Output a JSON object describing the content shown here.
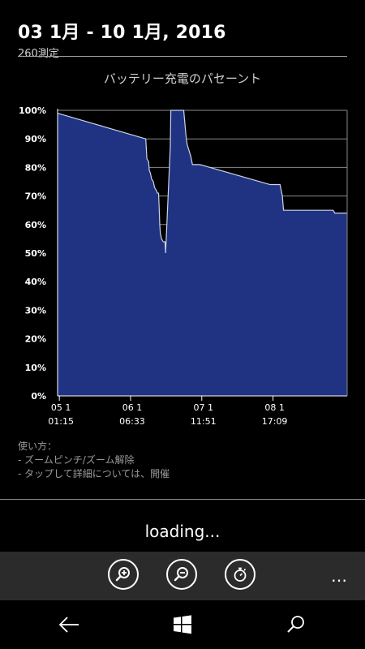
{
  "header": {
    "title": "03 1月 - 10 1月, 2016",
    "subtitle": "260測定"
  },
  "chart_data": {
    "type": "area",
    "title": "バッテリー充電のパセーント",
    "ylim": [
      0,
      100
    ],
    "y_ticks": [
      "0%",
      "10%",
      "20%",
      "30%",
      "40%",
      "50%",
      "60%",
      "70%",
      "80%",
      "90%",
      "100%"
    ],
    "x_ticks": [
      {
        "date": "05 1",
        "time": "01:15",
        "x": 1.0
      },
      {
        "date": "06 1",
        "time": "06:33",
        "x": 2.22
      },
      {
        "date": "07 1",
        "time": "11:51",
        "x": 3.44
      },
      {
        "date": "08 1",
        "time": "17:09",
        "x": 4.66
      }
    ],
    "xlim": [
      0.97,
      5.93
    ],
    "grid": true,
    "fill_color": "#1f3382",
    "line_color": "#cfd4e8",
    "points": [
      [
        0.97,
        99
      ],
      [
        2.48,
        90
      ],
      [
        2.5,
        83
      ],
      [
        2.53,
        82
      ],
      [
        2.54,
        79
      ],
      [
        2.56,
        78
      ],
      [
        2.58,
        76
      ],
      [
        2.61,
        75
      ],
      [
        2.63,
        73
      ],
      [
        2.66,
        72
      ],
      [
        2.68,
        71
      ],
      [
        2.7,
        71
      ],
      [
        2.71,
        66
      ],
      [
        2.72,
        60
      ],
      [
        2.73,
        57
      ],
      [
        2.75,
        55
      ],
      [
        2.78,
        54
      ],
      [
        2.81,
        54
      ],
      [
        2.82,
        50
      ],
      [
        2.9,
        87
      ],
      [
        2.91,
        100
      ],
      [
        3.13,
        100
      ],
      [
        3.17,
        91
      ],
      [
        3.19,
        88
      ],
      [
        3.22,
        86
      ],
      [
        3.25,
        84
      ],
      [
        3.28,
        81
      ],
      [
        3.41,
        81
      ],
      [
        4.61,
        74
      ],
      [
        4.78,
        74
      ],
      [
        4.82,
        70
      ],
      [
        4.84,
        65
      ],
      [
        5.69,
        65
      ],
      [
        5.72,
        64
      ],
      [
        5.93,
        64
      ]
    ]
  },
  "usage": {
    "heading": "使い方：",
    "line1": "- ズームピンチ/ズーム解除",
    "line2": "- タップして詳細については、開催"
  },
  "status": {
    "loading": "loading..."
  },
  "appbar": {
    "more": "…"
  },
  "colors": {
    "background": "#000000",
    "appbar": "#2b2b2b",
    "grid": "#8a8a8a"
  }
}
